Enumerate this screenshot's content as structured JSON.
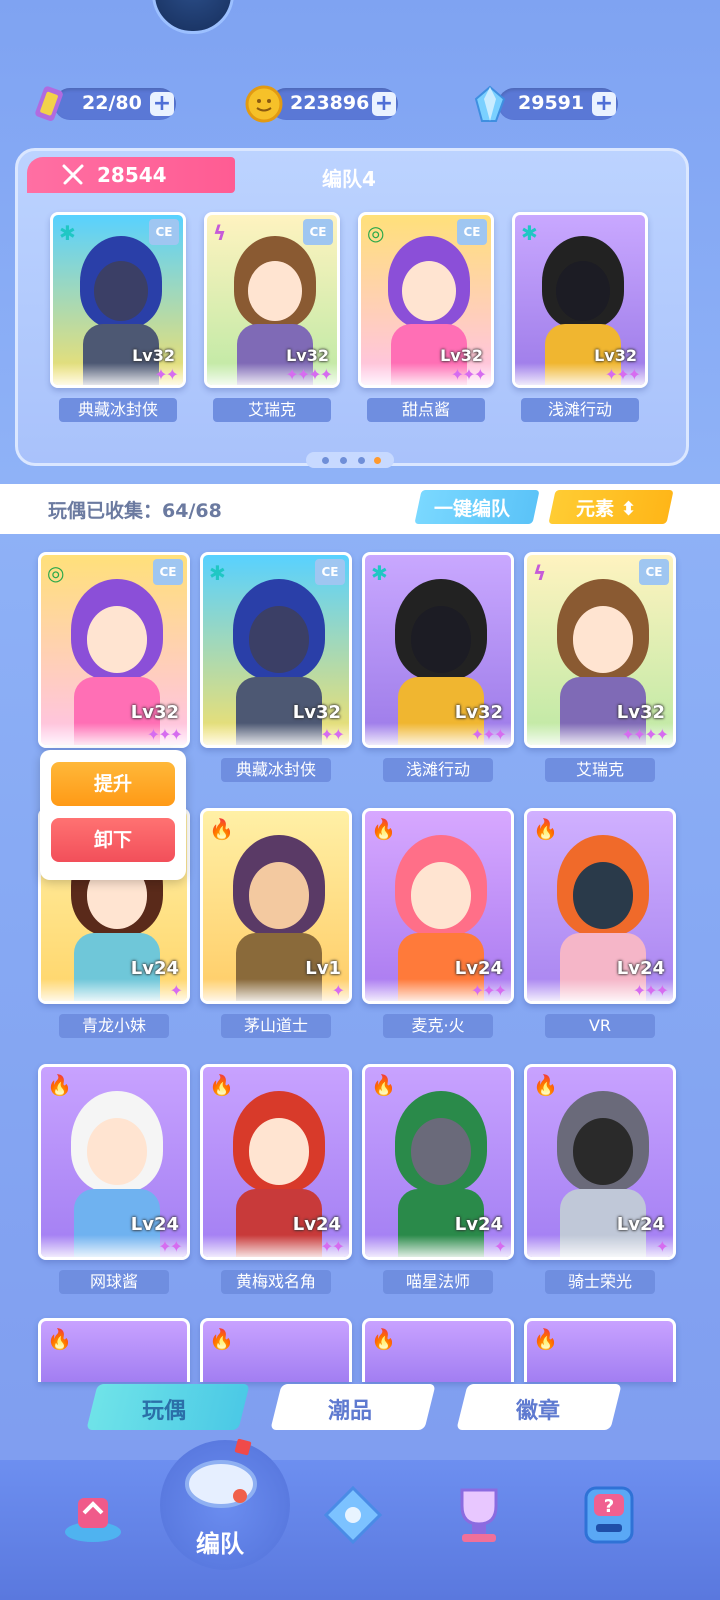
{
  "currencies": [
    {
      "name": "tickets",
      "value": "22/80",
      "icon": "ticket-icon"
    },
    {
      "name": "coins",
      "value": "223896",
      "icon": "coin-icon"
    },
    {
      "name": "crystals",
      "value": "29591",
      "icon": "crystal-icon"
    }
  ],
  "team": {
    "power": "28544",
    "name": "编队4",
    "members": [
      {
        "name": "典藏冰封侠",
        "level": "Lv32",
        "stars": "✦✦",
        "element": "✱",
        "elementColor": "#1fc7c4",
        "ce": "CE"
      },
      {
        "name": "艾瑞克",
        "level": "Lv32",
        "stars": "✦✦✦✦",
        "element": "ϟ",
        "elementColor": "#c65bd8",
        "ce": "CE"
      },
      {
        "name": "甜点酱",
        "level": "Lv32",
        "stars": "✦✦✦",
        "element": "◎",
        "elementColor": "#2aa84a",
        "ce": "CE"
      },
      {
        "name": "浅滩行动",
        "level": "Lv32",
        "stars": "✦✦✦",
        "element": "✱",
        "elementColor": "#1fc7c4",
        "ce": ""
      }
    ]
  },
  "collection": {
    "label": "玩偶已收集：",
    "value": "64/68"
  },
  "buttons": {
    "quick_team": "一键编队",
    "element": "元素 ⬍"
  },
  "popup": {
    "upgrade": "提升",
    "remove": "卸下"
  },
  "dolls": [
    {
      "name": "",
      "level": "Lv32",
      "stars": "✦✦✦",
      "element": "◎",
      "elementColor": "#2aa84a",
      "ce": "CE"
    },
    {
      "name": "典藏冰封侠",
      "level": "Lv32",
      "stars": "✦✦",
      "element": "✱",
      "elementColor": "#1fc7c4",
      "ce": "CE"
    },
    {
      "name": "浅滩行动",
      "level": "Lv32",
      "stars": "✦✦✦",
      "element": "✱",
      "elementColor": "#1fc7c4",
      "ce": ""
    },
    {
      "name": "艾瑞克",
      "level": "Lv32",
      "stars": "✦✦✦✦",
      "element": "ϟ",
      "elementColor": "#c65bd8",
      "ce": "CE"
    },
    {
      "name": "青龙小妹",
      "level": "Lv24",
      "stars": "✦",
      "element": "🔥",
      "elementColor": "#e3342f",
      "ce": ""
    },
    {
      "name": "茅山道士",
      "level": "Lv1",
      "stars": "✦",
      "element": "🔥",
      "elementColor": "#e3342f",
      "ce": ""
    },
    {
      "name": "麦克·火",
      "level": "Lv24",
      "stars": "✦✦✦",
      "element": "🔥",
      "elementColor": "#e3342f",
      "ce": ""
    },
    {
      "name": "VR",
      "level": "Lv24",
      "stars": "✦✦✦",
      "element": "🔥",
      "elementColor": "#e3342f",
      "ce": ""
    },
    {
      "name": "网球酱",
      "level": "Lv24",
      "stars": "✦✦",
      "element": "🔥",
      "elementColor": "#e3342f",
      "ce": ""
    },
    {
      "name": "黄梅戏名角",
      "level": "Lv24",
      "stars": "✦✦",
      "element": "🔥",
      "elementColor": "#e3342f",
      "ce": ""
    },
    {
      "name": "喵星法师",
      "level": "Lv24",
      "stars": "✦",
      "element": "🔥",
      "elementColor": "#e3342f",
      "ce": ""
    },
    {
      "name": "骑士荣光",
      "level": "Lv24",
      "stars": "✦",
      "element": "🔥",
      "elementColor": "#e3342f",
      "ce": ""
    }
  ],
  "tabs": {
    "dolls": "玩偶",
    "trend": "潮品",
    "badges": "徽章"
  },
  "nav": {
    "team": "编队"
  },
  "colors": {
    "accent_pink": "#ff5c93",
    "accent_yellow": "#ffb618",
    "accent_cyan": "#5bc3f8",
    "name_plate": "#6f8ee0"
  }
}
